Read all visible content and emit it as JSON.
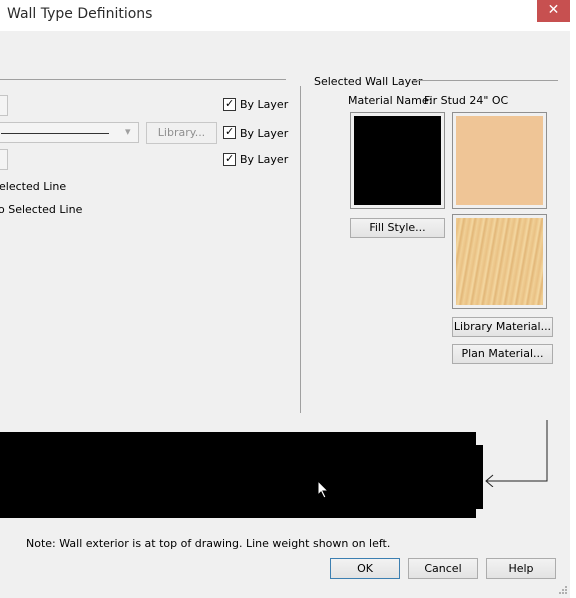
{
  "window": {
    "title": "Wall Type Definitions",
    "close_glyph": "✕"
  },
  "left_panel": {
    "by_layer_1": "By Layer",
    "by_layer_2": "By Layer",
    "by_layer_3": "By Layer",
    "library_button": "Library...",
    "option_1": "elected Line",
    "option_2": "o Selected Line"
  },
  "selected_layer": {
    "group_label": "Selected Wall Layer",
    "material_name_label": "Material Name:",
    "material_name_value": "Fir Stud 24\" OC",
    "fill_style_button": "Fill Style...",
    "library_material_button": "Library Material...",
    "plan_material_button": "Plan Material...",
    "fill_color": "#000000",
    "material_color": "#efc596"
  },
  "note": "Note: Wall exterior is at top of drawing. Line weight shown on left.",
  "footer": {
    "ok": "OK",
    "cancel": "Cancel",
    "help": "Help"
  },
  "check_glyph": "✓",
  "dropdown_glyph": "▾"
}
